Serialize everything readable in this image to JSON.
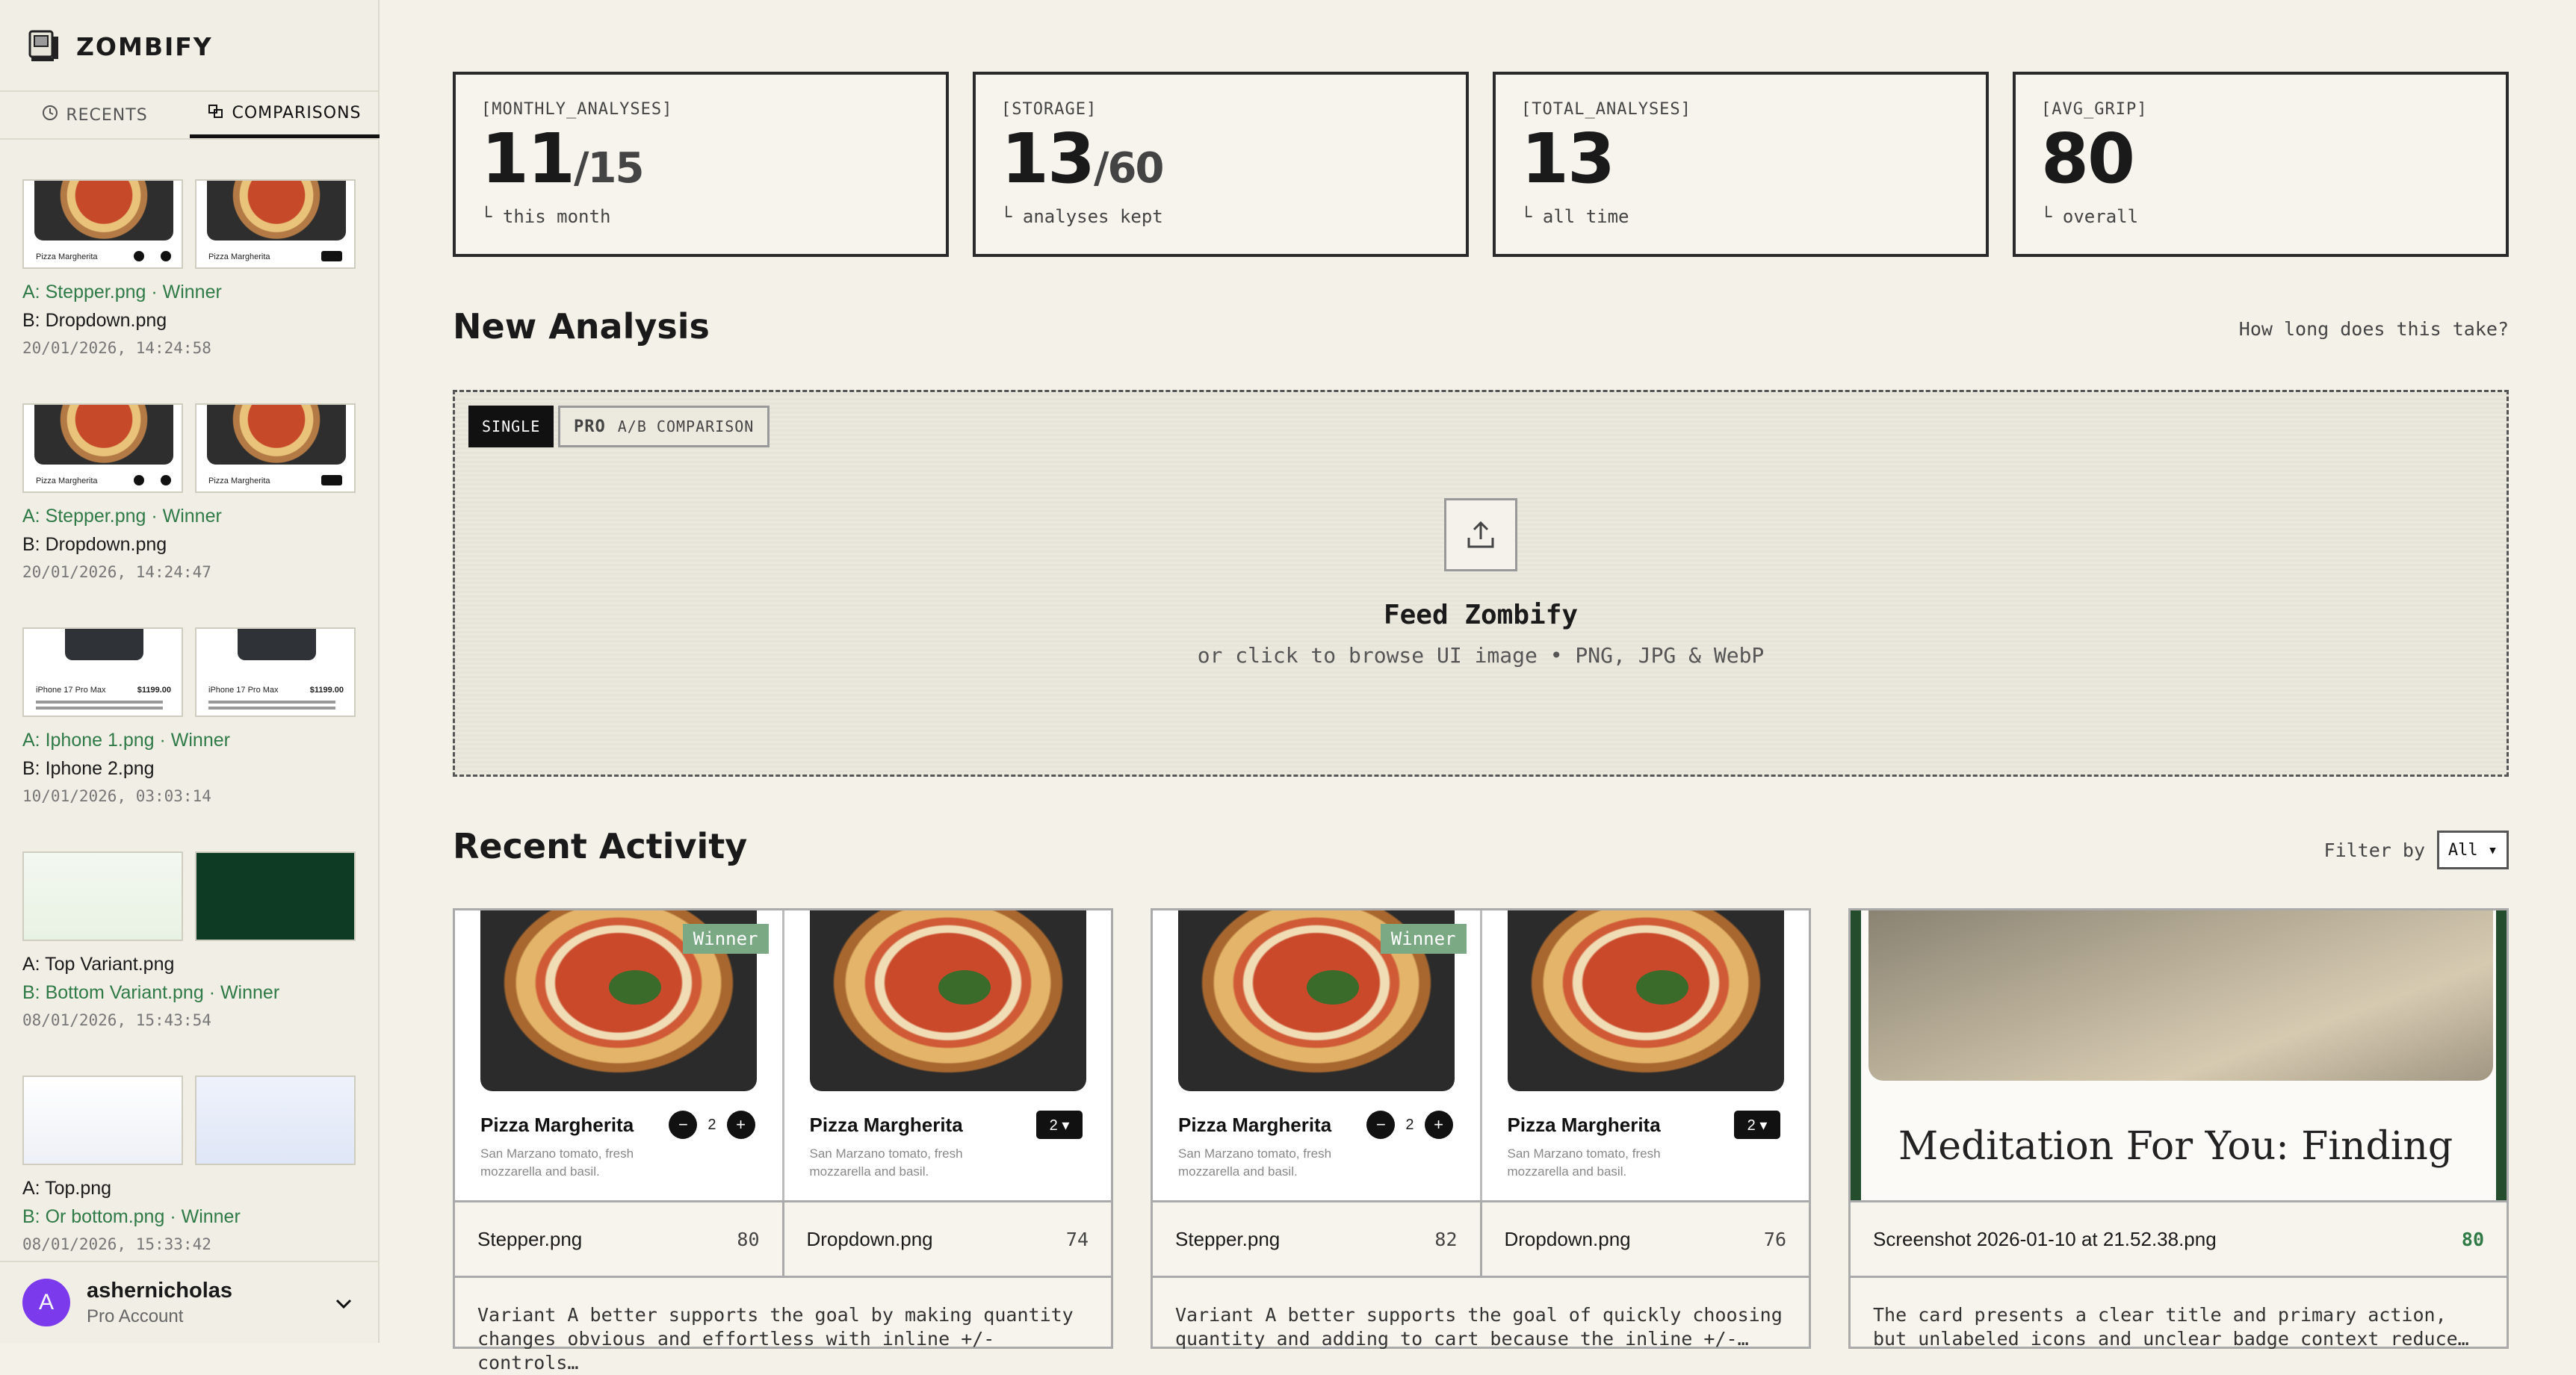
{
  "app": {
    "name": "ZOMBIFY"
  },
  "sidebar": {
    "tabs": [
      {
        "label": "RECENTS"
      },
      {
        "label": "COMPARISONS"
      }
    ],
    "comparisons": [
      {
        "a": "A: Stepper.png",
        "b": "B: Dropdown.png",
        "winner": "A",
        "date": "20/01/2026, 14:24:58",
        "thumb_caption": "Pizza Margherita"
      },
      {
        "a": "A: Stepper.png",
        "b": "B: Dropdown.png",
        "winner": "A",
        "date": "20/01/2026, 14:24:47",
        "thumb_caption": "Pizza Margherita"
      },
      {
        "a": "A: Iphone 1.png",
        "b": "B: Iphone 2.png",
        "winner": "A",
        "date": "10/01/2026, 03:03:14",
        "thumb_caption": "iPhone 17 Pro Max",
        "thumb_price": "$1199.00"
      },
      {
        "a": "A: Top Variant.png",
        "b": "B: Bottom Variant.png",
        "winner": "B",
        "date": "08/01/2026, 15:43:54"
      },
      {
        "a": "A: Top.png",
        "b": "B: Or bottom.png",
        "winner": "B",
        "date": "08/01/2026, 15:33:42"
      }
    ],
    "winner_label": "· Winner",
    "user": {
      "initial": "A",
      "name": "ashernicholas",
      "plan": "Pro Account"
    }
  },
  "stats": [
    {
      "label": "[MONTHLY_ANALYSES]",
      "value": "11",
      "sub": "/15",
      "note": "└ this month"
    },
    {
      "label": "[STORAGE]",
      "value": "13",
      "sub": "/60",
      "note": "└ analyses kept"
    },
    {
      "label": "[TOTAL_ANALYSES]",
      "value": "13",
      "sub": "",
      "note": "└ all time"
    },
    {
      "label": "[AVG_GRIP]",
      "value": "80",
      "sub": "",
      "note": "└ overall"
    }
  ],
  "new_analysis": {
    "title": "New Analysis",
    "help": "How long does this take?",
    "mode_single": "SINGLE",
    "mode_pro_tag": "PRO",
    "mode_pro": "A/B COMPARISON",
    "drop_title": "Feed Zombify",
    "drop_sub": "or click to browse UI image • PNG, JPG & WebP"
  },
  "recent": {
    "title": "Recent Activity",
    "filter_label": "Filter by",
    "filter_value": "All ▾",
    "winner_badge": "Winner",
    "pizza_title": "Pizza Margherita",
    "pizza_desc": "San Marzano tomato, fresh mozzarella and basil.",
    "stepper_qty": "2",
    "dropdown_qty": "2 ▾",
    "cards": [
      {
        "a_name": "Stepper.png",
        "a_score": "80",
        "b_name": "Dropdown.png",
        "b_score": "74",
        "desc": "Variant A better supports the goal by making quantity changes obvious and effortless with inline +/- controls…"
      },
      {
        "a_name": "Stepper.png",
        "a_score": "82",
        "b_name": "Dropdown.png",
        "b_score": "76",
        "desc": "Variant A better supports the goal of quickly choosing quantity and adding to cart because the inline +/-…"
      },
      {
        "name": "Screenshot 2026-01-10 at 21.52.38.png",
        "score": "80",
        "headline": "Meditation For You: Finding",
        "desc": "The card presents a clear title and primary action, but unlabeled icons and unclear badge context reduce…"
      }
    ]
  },
  "colors": {
    "winner_green": "#2f7a47",
    "badge_green": "#7aa984",
    "avatar": "#7c3aed"
  }
}
